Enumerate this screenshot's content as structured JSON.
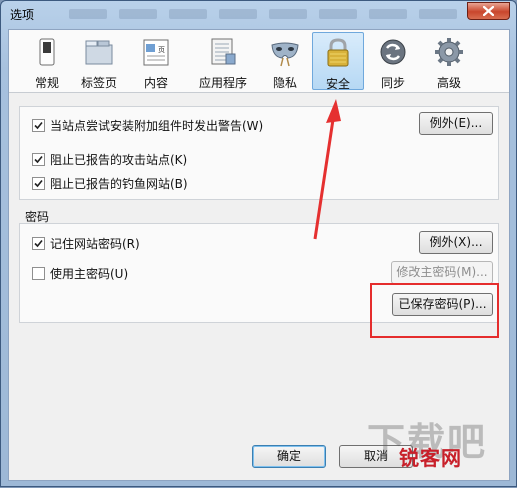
{
  "window": {
    "title": "选项"
  },
  "toolbar": {
    "items": [
      {
        "label": "常规",
        "icon": "switch-icon"
      },
      {
        "label": "标签页",
        "icon": "folder-tabs-icon"
      },
      {
        "label": "内容",
        "icon": "page-content-icon"
      },
      {
        "label": "应用程序",
        "icon": "applications-icon"
      },
      {
        "label": "隐私",
        "icon": "mask-icon"
      },
      {
        "label": "安全",
        "icon": "padlock-icon"
      },
      {
        "label": "同步",
        "icon": "sync-icon"
      },
      {
        "label": "高级",
        "icon": "gear-icon"
      }
    ],
    "active": "安全"
  },
  "security": {
    "warn_addons": {
      "label": "当站点尝试安装附加组件时发出警告(W)",
      "checked": true
    },
    "exceptions_label": "例外(E)...",
    "block_attack": {
      "label": "阻止已报告的攻击站点(K)",
      "checked": true
    },
    "block_forgery": {
      "label": "阻止已报告的钓鱼网站(B)",
      "checked": true
    }
  },
  "passwords": {
    "section_label": "密码",
    "remember": {
      "label": "记住网站密码(R)",
      "checked": true
    },
    "exceptions_label": "例外(X)...",
    "master": {
      "label": "使用主密码(U)",
      "checked": false
    },
    "change_master_label": "修改主密码(M)...",
    "saved_label": "已保存密码(P)..."
  },
  "footer": {
    "ok_label": "确定",
    "cancel_label": "取消"
  },
  "watermark": {
    "text": "锐客网",
    "faded_text": "下载吧"
  },
  "colors": {
    "highlight": "#e52d2d",
    "accent": "#3c7fb1"
  }
}
